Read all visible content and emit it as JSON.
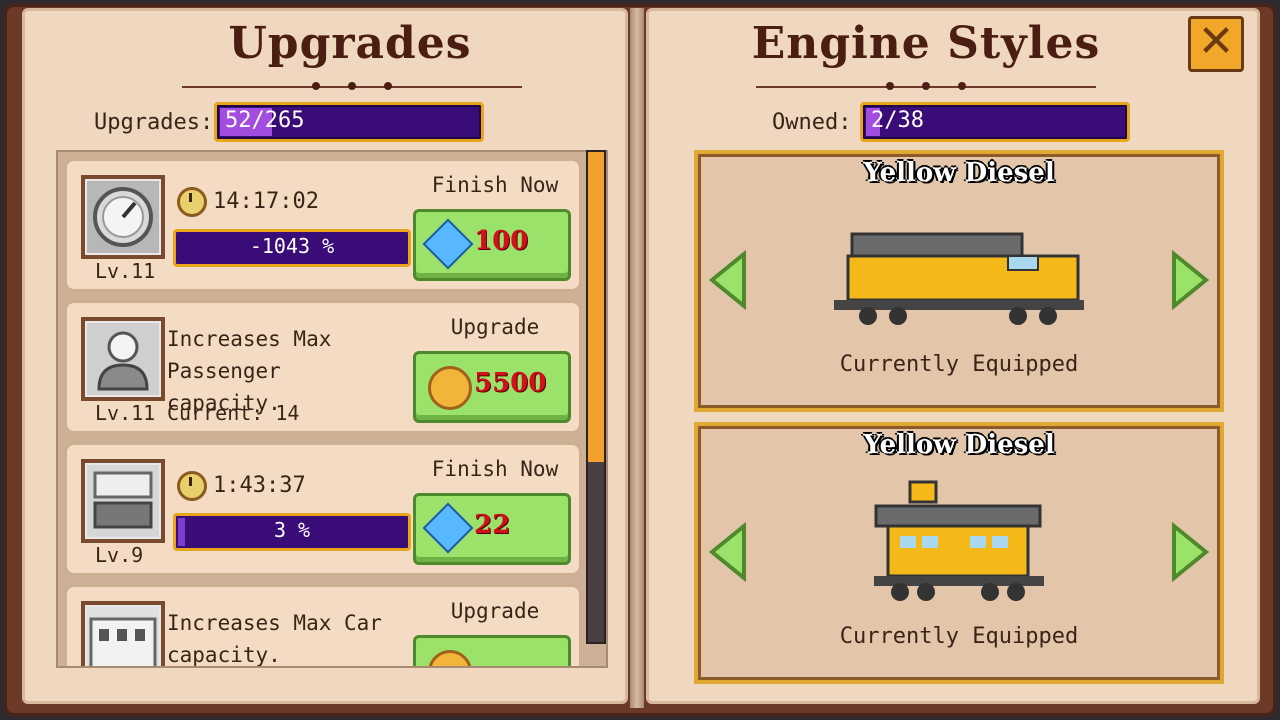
{
  "left_page": {
    "title": "Upgrades",
    "counter_label": "Upgrades:",
    "counter_value": "52/265",
    "counter_fraction": 0.196
  },
  "right_page": {
    "title": "Engine Styles",
    "counter_label": "Owned:",
    "counter_value": "2/38",
    "counter_fraction": 0.053
  },
  "upgrades": [
    {
      "kind": "timer",
      "level": "Lv.11",
      "timer": "14:17:02",
      "progress_label": "-1043 %",
      "progress": 0.0,
      "action_label": "Finish Now",
      "currency": "gem",
      "cost": "100",
      "icon": "speedometer-icon"
    },
    {
      "kind": "desc",
      "level": "Lv.11",
      "description_1": "Increases Max",
      "description_2": "Passenger capacity.",
      "current": "Current: 14",
      "action_label": "Upgrade",
      "currency": "coin",
      "cost": "5500",
      "icon": "passenger-icon"
    },
    {
      "kind": "timer",
      "level": "Lv.9",
      "timer": "1:43:37",
      "progress_label": "3 %",
      "progress": 0.03,
      "action_label": "Finish Now",
      "currency": "gem",
      "cost": "22",
      "icon": "train-car-icon"
    },
    {
      "kind": "desc",
      "level": "",
      "description_1": "Increases Max Car",
      "description_2": "capacity.",
      "current": "",
      "action_label": "Upgrade",
      "currency": "coin",
      "cost": "",
      "icon": "depot-icon"
    }
  ],
  "styles": [
    {
      "name": "Yellow Diesel",
      "status": "Currently Equipped",
      "icon": "yellow-diesel-locomotive-icon"
    },
    {
      "name": "Yellow Diesel",
      "status": "Currently Equipped",
      "icon": "yellow-diesel-caboose-icon"
    }
  ],
  "colors": {
    "bar_purple": "#3a0c78",
    "bar_border": "#e8a41a",
    "button_green": "#9be26a",
    "cost_red": "#d0101a"
  }
}
